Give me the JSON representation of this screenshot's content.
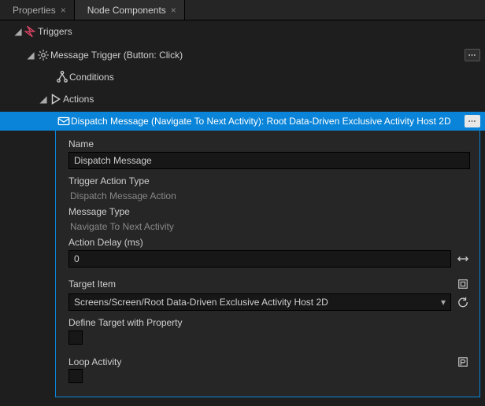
{
  "tabs": {
    "properties": "Properties",
    "node_components": "Node Components"
  },
  "tree": {
    "triggers": "Triggers",
    "message_trigger": "Message Trigger (Button: Click)",
    "conditions": "Conditions",
    "actions": "Actions",
    "dispatch": "Dispatch Message (Navigate To Next Activity): Root Data-Driven Exclusive Activity Host 2D"
  },
  "details": {
    "name_label": "Name",
    "name_value": "Dispatch Message",
    "trigger_action_type_label": "Trigger Action Type",
    "trigger_action_type_value": "Dispatch Message Action",
    "message_type_label": "Message Type",
    "message_type_value": "Navigate To Next Activity",
    "action_delay_label": "Action Delay (ms)",
    "action_delay_value": "0",
    "target_item_label": "Target Item",
    "target_item_value": "Screens/Screen/Root Data-Driven Exclusive Activity Host 2D",
    "define_target_label": "Define Target with Property",
    "loop_activity_label": "Loop Activity"
  }
}
